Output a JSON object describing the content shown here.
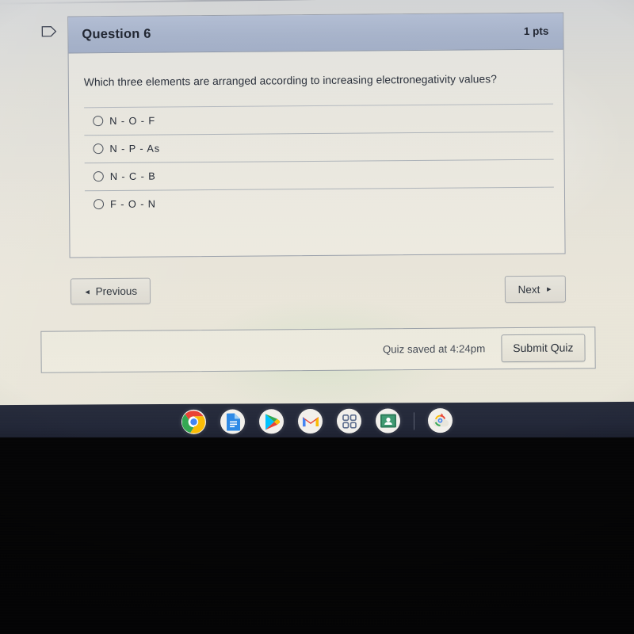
{
  "quiz": {
    "flag_icon": "flag-outline-icon",
    "question": {
      "title": "Question 6",
      "points": "1 pts",
      "text": "Which three elements are arranged according to increasing electronegativity values?",
      "options": [
        {
          "label": "N - O - F",
          "selected": false
        },
        {
          "label": "N - P - As",
          "selected": false
        },
        {
          "label": "N - C - B",
          "selected": false
        },
        {
          "label": "F - O - N",
          "selected": false
        }
      ]
    },
    "navigation": {
      "previous_label": "Previous",
      "previous_arrow": "◄",
      "next_label": "Next",
      "next_arrow": "►"
    },
    "footer": {
      "saved_status": "Quiz saved at 4:24pm",
      "submit_label": "Submit Quiz"
    },
    "colors": {
      "header_blue": "#a8b4cb",
      "page_bg": "#e9e6d9",
      "shelf_navy": "#232839"
    }
  },
  "shelf": {
    "items": [
      {
        "name": "chrome-icon",
        "label": "Chrome",
        "running": true
      },
      {
        "name": "google-docs-icon",
        "label": "Docs",
        "running": false
      },
      {
        "name": "play-store-icon",
        "label": "Play Store",
        "running": false
      },
      {
        "name": "gmail-icon",
        "label": "Gmail",
        "running": false
      },
      {
        "name": "apps-grid-icon",
        "label": "Apps",
        "running": false
      },
      {
        "name": "google-classroom-icon",
        "label": "Classroom",
        "running": false
      },
      {
        "name": "sync-cloud-icon",
        "label": "Sync",
        "running": true
      }
    ]
  }
}
